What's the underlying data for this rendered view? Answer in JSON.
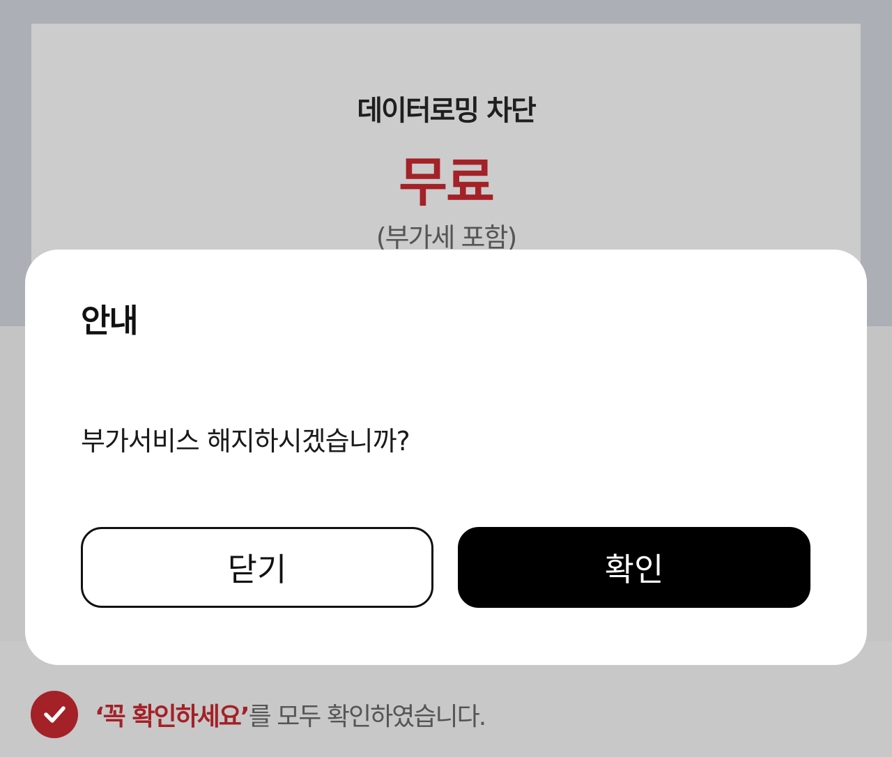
{
  "colors": {
    "accent": "#a32127",
    "overlay_top": "#acafb6",
    "overlay_bottom": "#c4c4c4",
    "dialog_bg": "#ffffff",
    "confirm_button": "#000000"
  },
  "price_card": {
    "title": "데이터로밍 차단",
    "price": "무료",
    "vat_note": "(부가세 포함)"
  },
  "dialog": {
    "title": "안내",
    "message": "부가서비스 해지하시겠습니까?",
    "close_label": "닫기",
    "confirm_label": "확인"
  },
  "agreement": {
    "icon": "check-circle-icon",
    "highlight": "‘꼭 확인하세요’",
    "text": "를 모두 확인하였습니다."
  }
}
